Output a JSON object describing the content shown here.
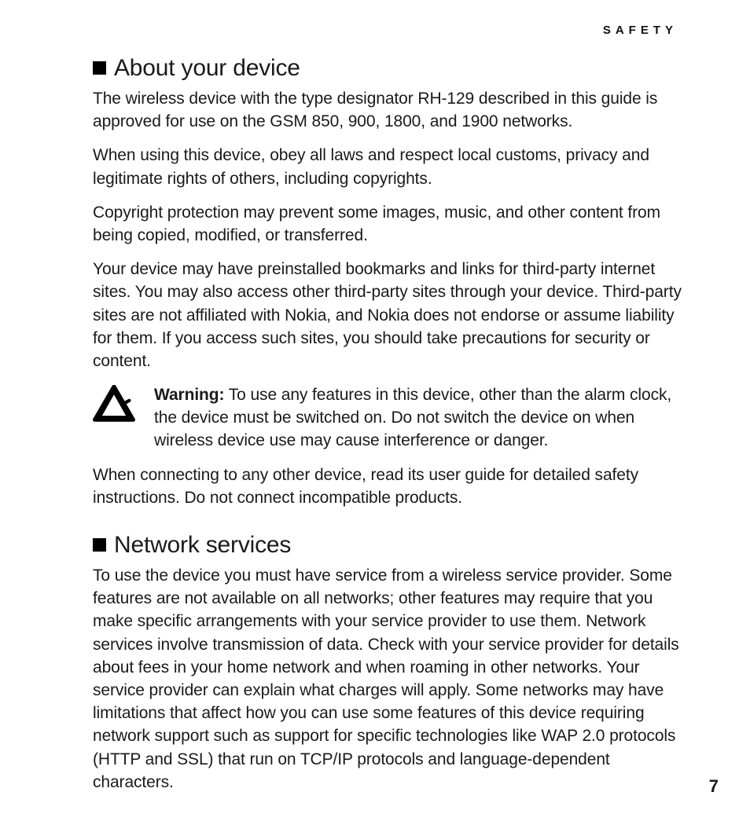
{
  "runningHead": "SAFETY",
  "pageNumber": "7",
  "sections": [
    {
      "title": "About your device",
      "paras": [
        "The wireless device with the type designator RH-129 described in this guide is approved for use on the GSM 850, 900, 1800, and 1900 networks.",
        "When using this device, obey all laws and respect local customs, privacy and legitimate rights of others, including copyrights.",
        "Copyright protection may prevent some images, music, and other content from being copied, modified, or transferred.",
        "Your device may have preinstalled bookmarks and links for third-party internet sites. You may also access other third-party sites through your device. Third-party sites are not affiliated with Nokia, and Nokia does not endorse or assume liability for them. If you access such sites, you should take precautions for security or content."
      ],
      "warning": {
        "label": "Warning:",
        "text": " To use any features in this device, other than the alarm clock, the device must be switched on. Do not switch the device on when wireless device use may cause interference or danger."
      },
      "parasAfter": [
        "When connecting to any other device, read its user guide for detailed safety instructions. Do not connect incompatible products."
      ]
    },
    {
      "title": "Network services",
      "paras": [
        "To use the device you must have service from a wireless service provider. Some features are not available on all networks; other features may require that you make specific arrangements with your service provider to use them. Network services involve transmission of data. Check with your service provider for details about fees in your home network and when roaming in other networks. Your service provider can explain what charges will apply. Some networks may have limitations that affect how you can use some features of this device requiring network support such as support for specific technologies like WAP 2.0 protocols (HTTP and SSL) that run on TCP/IP protocols and language-dependent characters."
      ]
    }
  ]
}
